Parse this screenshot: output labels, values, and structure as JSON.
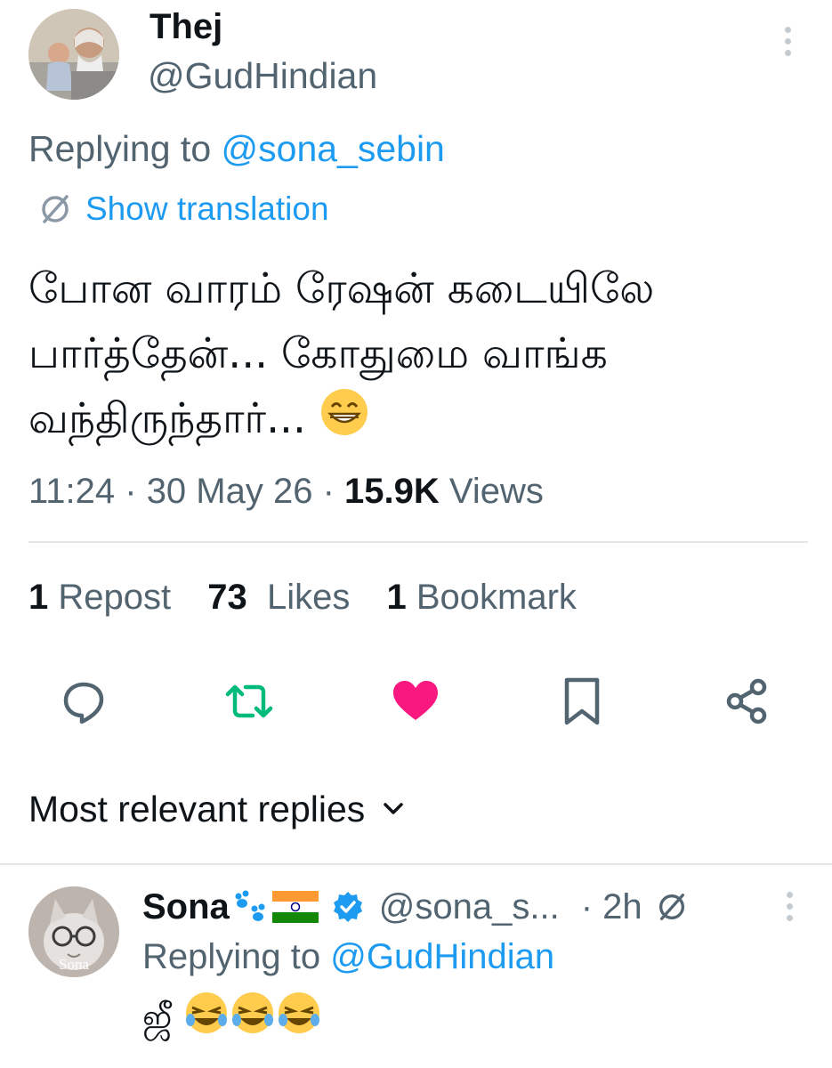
{
  "tweet": {
    "author_name": "Thej",
    "author_handle": "@GudHindian",
    "replying_prefix": "Replying to ",
    "replying_handle": "@sona_sebin",
    "translate_label": "Show translation",
    "text_lines": [
      "போன வாரம் ரேஷன் கடையிலே",
      "பார்த்தேன்... கோதுமை வாங்க",
      "வந்திருந்தார்... "
    ],
    "emoji": "grinning-face-with-smiling-eyes",
    "time": "11:24",
    "date": "30 May 26",
    "views_count": "15.9K",
    "views_label": "Views"
  },
  "stats": {
    "reposts_count": "1",
    "reposts_label": "Repost",
    "likes_count": "73",
    "likes_label": "Likes",
    "bookmarks_count": "1",
    "bookmarks_label": "Bookmark"
  },
  "actions": {
    "like_color": "#f91880",
    "repost_color": "#00ba7c",
    "icon_color": "#536471"
  },
  "replies": {
    "sort_label": "Most relevant replies",
    "items": [
      {
        "name": "Sona",
        "handle": "@sona_s...",
        "time": "· 2h",
        "replying_prefix": "Replying to ",
        "replying_handle": "@GudHindian",
        "text": "ஜீ",
        "avatar_label": "Sona"
      }
    ]
  }
}
